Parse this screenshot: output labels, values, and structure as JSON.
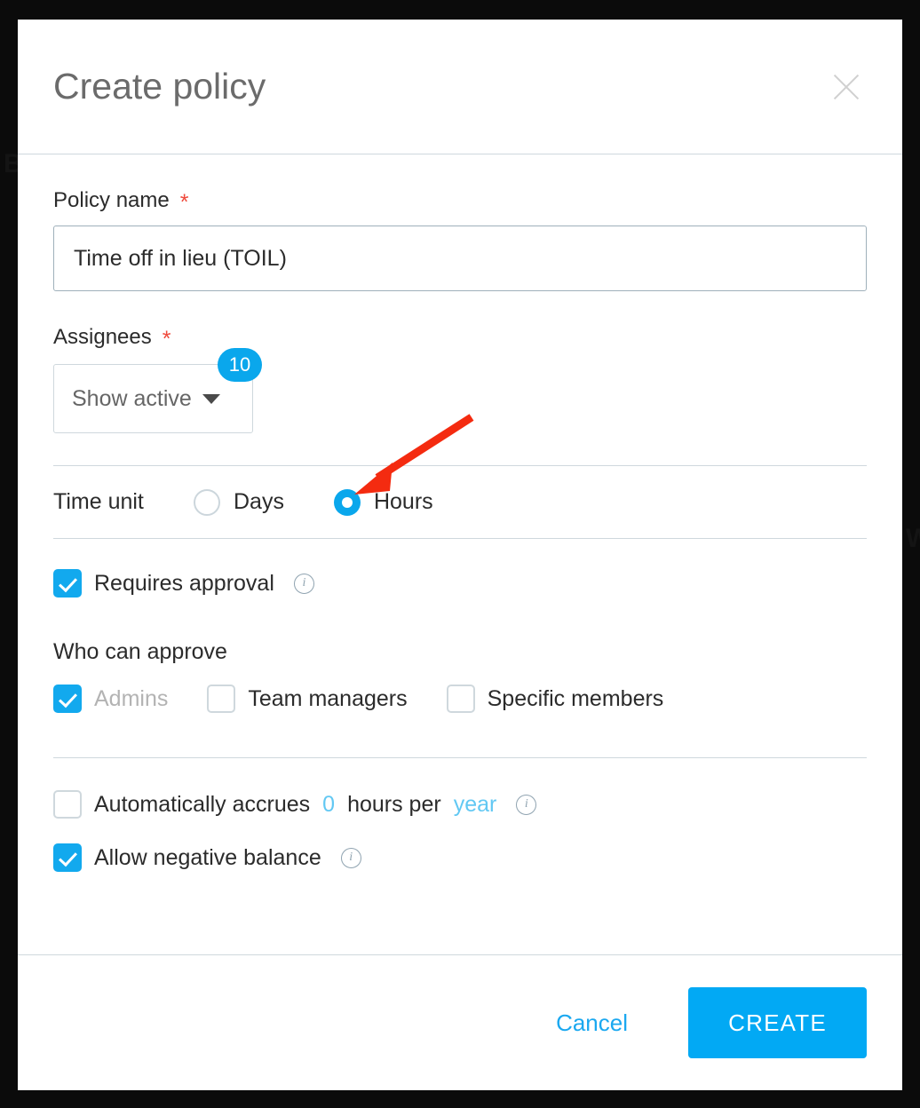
{
  "modal": {
    "title": "Create policy",
    "close_icon": "close-icon"
  },
  "policy_name": {
    "label": "Policy name",
    "required_marker": "*",
    "value": "Time off in lieu (TOIL)",
    "placeholder": ""
  },
  "assignees": {
    "label": "Assignees",
    "required_marker": "*",
    "dropdown_value": "Show active",
    "dropdown_icon": "chevron-down-icon",
    "badge_count": "10"
  },
  "time_unit": {
    "label": "Time unit",
    "options": [
      {
        "label": "Days",
        "selected": false
      },
      {
        "label": "Hours",
        "selected": true
      }
    ]
  },
  "approval": {
    "requires_approval_label": "Requires approval",
    "requires_approval_checked": true,
    "info_icon_glyph": "i",
    "who_can_approve_label": "Who can approve",
    "who_options": [
      {
        "label": "Admins",
        "checked": true,
        "disabled": true
      },
      {
        "label": "Team managers",
        "checked": false,
        "disabled": false
      },
      {
        "label": "Specific members",
        "checked": false,
        "disabled": false
      }
    ]
  },
  "accrual": {
    "checked": false,
    "prefix": "Automatically accrues",
    "amount": "0",
    "middle": "hours per",
    "period": "year",
    "info_icon_glyph": "i"
  },
  "negative_balance": {
    "label": "Allow negative balance",
    "checked": true,
    "info_icon_glyph": "i"
  },
  "footer": {
    "cancel_label": "Cancel",
    "create_label": "CREATE"
  },
  "annotation": {
    "type": "arrow",
    "color": "#f42b10",
    "points_to": "hours-radio"
  },
  "colors": {
    "accent_blue": "#02a9f4",
    "badge_blue": "#0aa7ec",
    "required_red": "#ef4a3c",
    "annotation_red": "#f42b10",
    "border_gray": "#cfd8dd",
    "title_gray": "#6b6b6b",
    "text_dark": "#2b2b2b",
    "inline_value_blue": "#62c8f3",
    "backdrop": "#0b0b0b"
  },
  "backdrop": {
    "ghost_left": "B",
    "ghost_right": "W"
  }
}
